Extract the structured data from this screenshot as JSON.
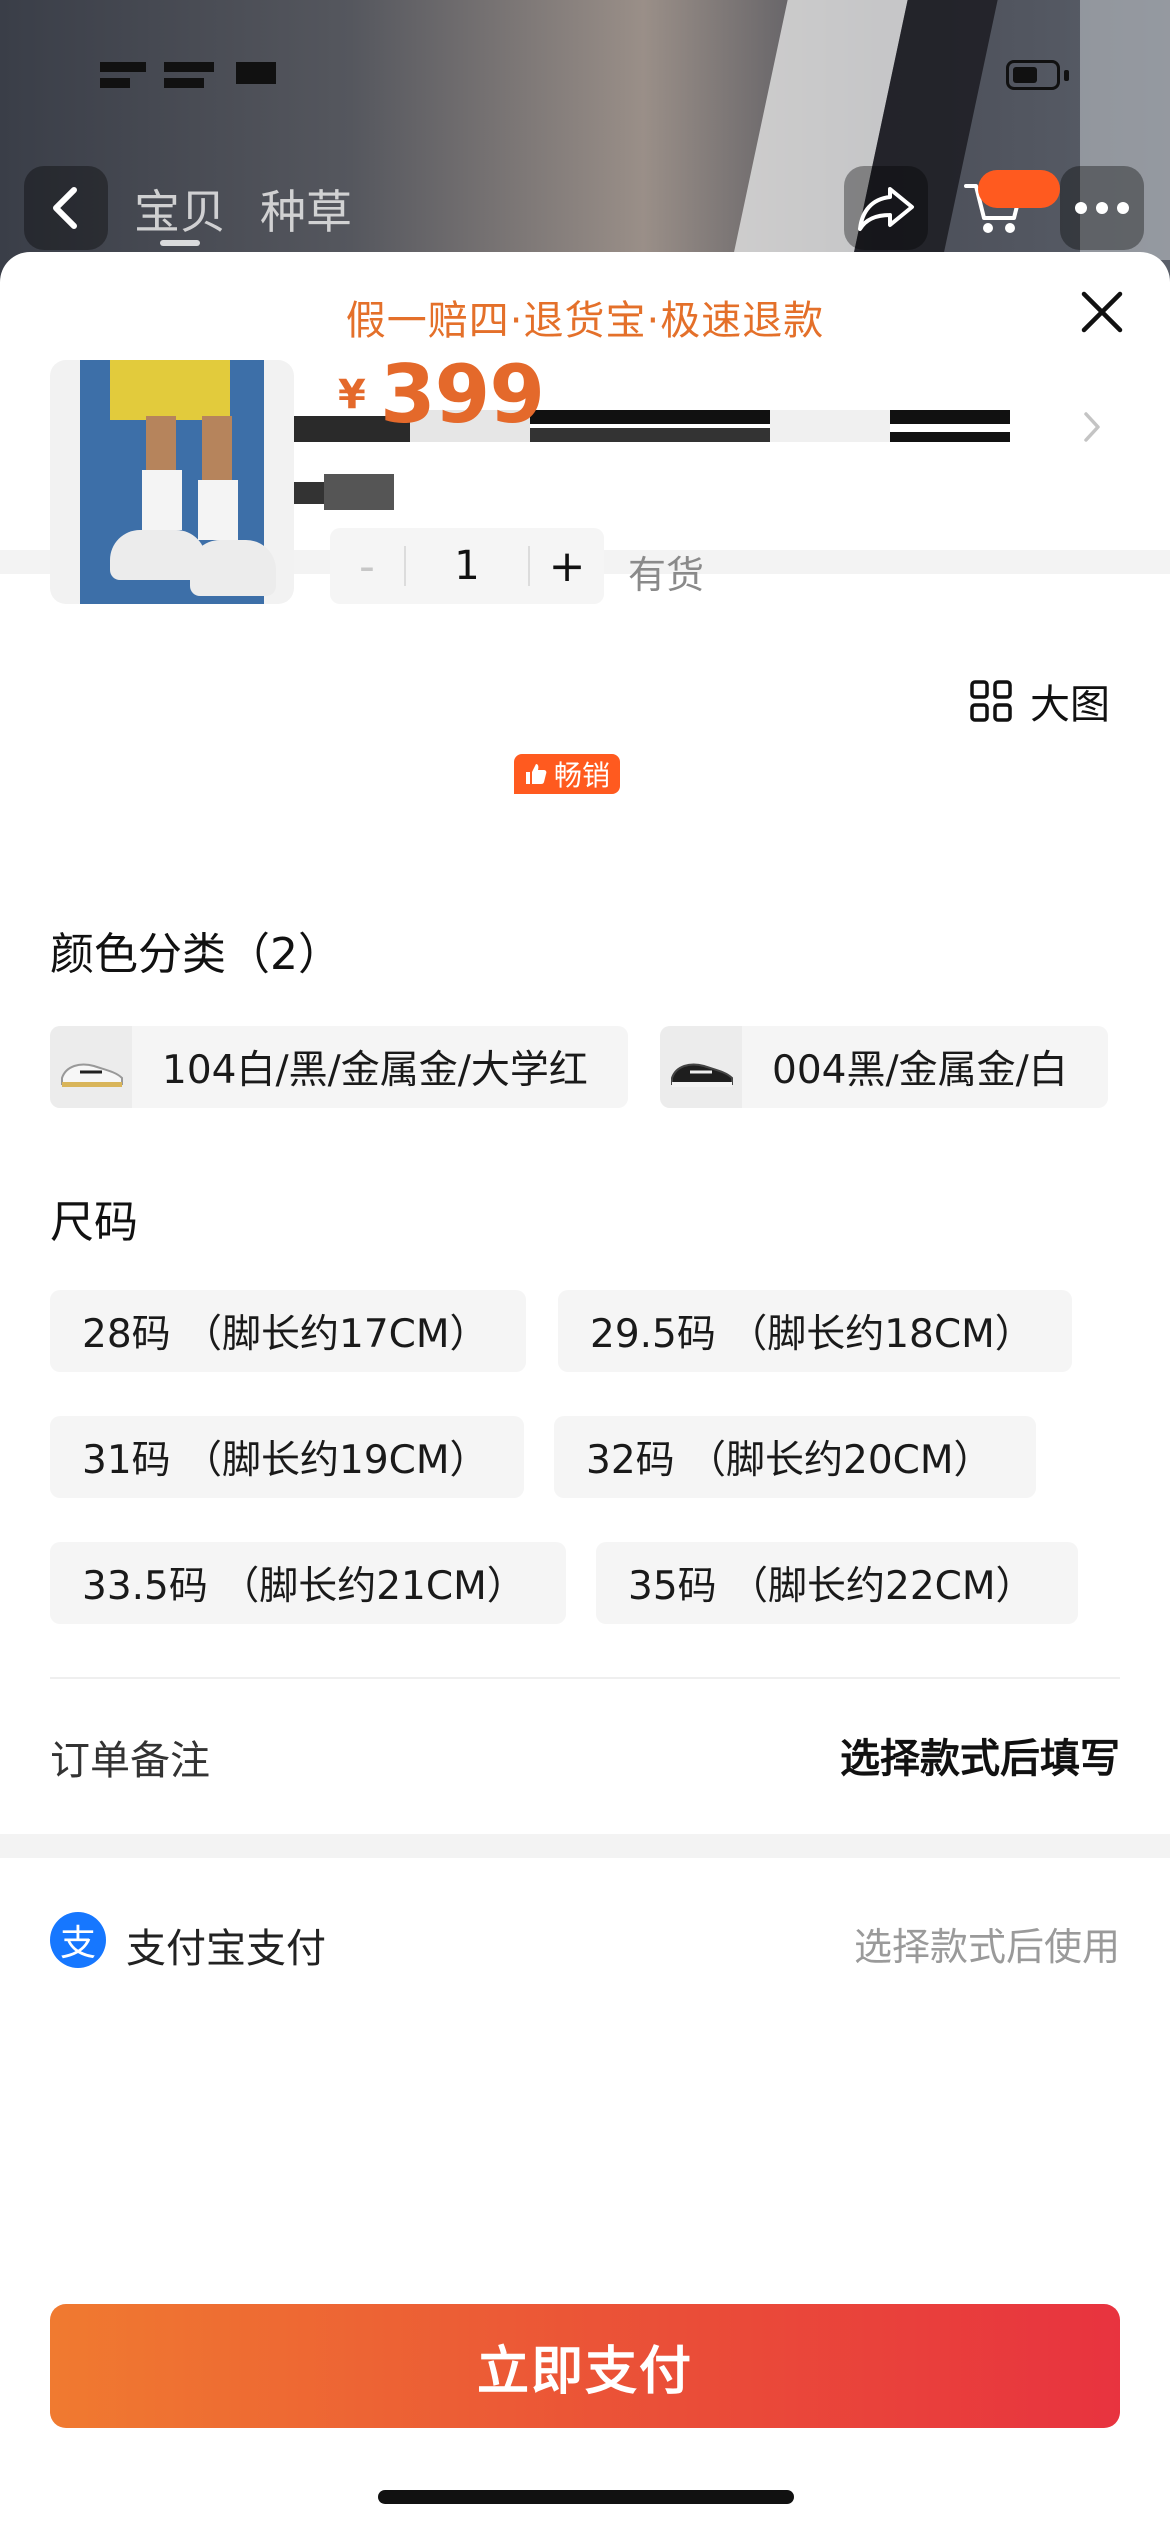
{
  "header": {
    "tabs": [
      "宝贝",
      "种草"
    ],
    "back_icon": "chevron-left-icon",
    "share_icon": "share-icon",
    "cart_icon": "cart-icon",
    "more_icon": "more-icon"
  },
  "sheet": {
    "promo": "假一赔四·退货宝·极速退款",
    "close_icon": "close-icon"
  },
  "product": {
    "currency": "¥",
    "price": "399",
    "quantity": "1",
    "minus": "-",
    "plus": "+",
    "stock": "有货"
  },
  "color_section": {
    "title": "颜色分类（2）",
    "big_view": "大图",
    "options": [
      {
        "label": "104白/黑/金属金/大学红",
        "badge": "畅销"
      },
      {
        "label": "004黑/金属金/白"
      }
    ]
  },
  "size_section": {
    "title": "尺码",
    "options": [
      "28码 （脚长约17CM）",
      "29.5码 （脚长约18CM）",
      "31码 （脚长约19CM）",
      "32码 （脚长约20CM）",
      "33.5码 （脚长约21CM）",
      "35码 （脚长约22CM）"
    ]
  },
  "remark": {
    "label": "订单备注",
    "value": "选择款式后填写"
  },
  "payment": {
    "icon_char": "支",
    "label": "支付宝支付",
    "hint": "选择款式后使用"
  },
  "pay_button": "立即支付",
  "colors": {
    "accent": "#e4692b",
    "badge": "#ff5a1f",
    "alipay": "#1677ff"
  }
}
